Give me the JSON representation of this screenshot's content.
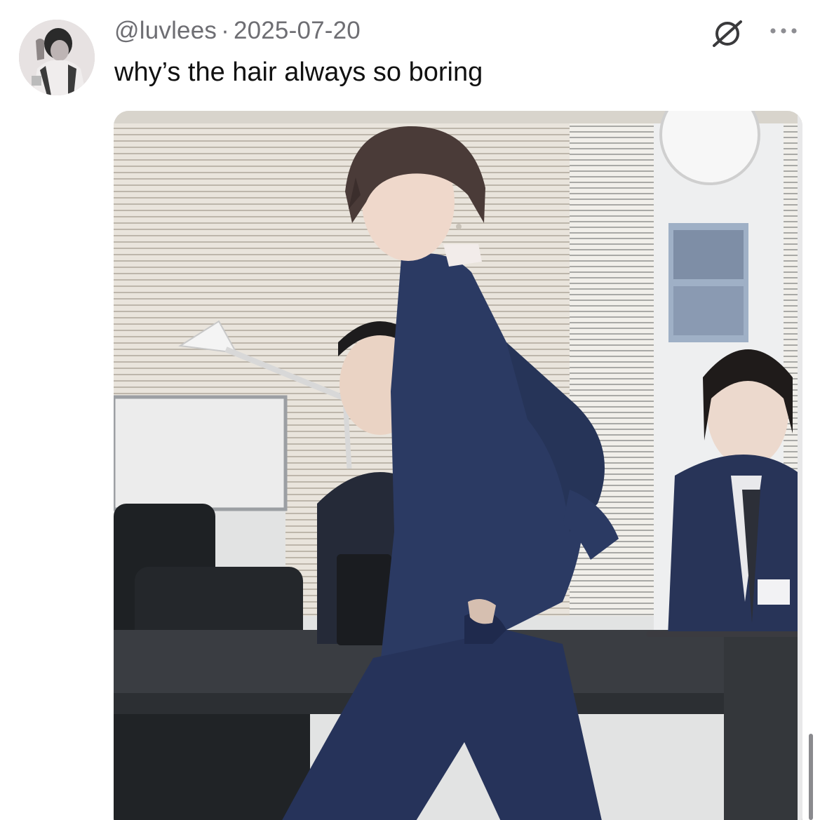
{
  "post": {
    "author_handle": "@luvlees",
    "separator": "·",
    "date": "2025-07-20",
    "text": "why’s the hair always so boring"
  },
  "media": {
    "description_icon": "photo"
  },
  "icons": {
    "hide": "eye-slash-icon",
    "more": "more-dots-icon"
  },
  "colors": {
    "meta_text": "#6e6e73",
    "body_text": "#111111",
    "icon": "#3a3a3c",
    "suit": "#2b3a63"
  }
}
